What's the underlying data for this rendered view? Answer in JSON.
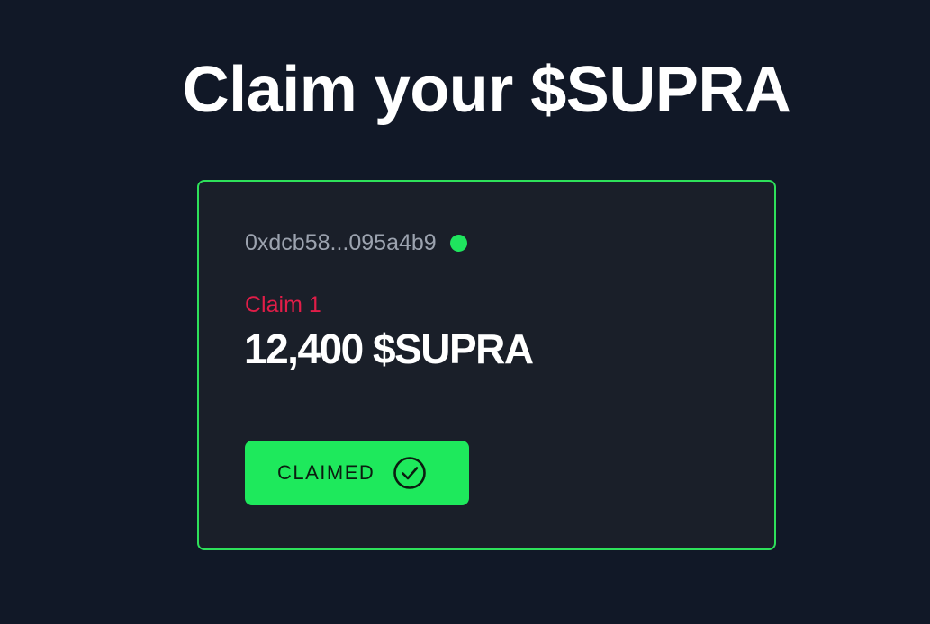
{
  "page": {
    "title": "Claim your $SUPRA"
  },
  "card": {
    "wallet_address": "0xdcb58...095a4b9",
    "wallet_status": "connected",
    "claim_label": "Claim 1",
    "claim_amount": "12,400 $SUPRA",
    "button_label": "CLAIMED",
    "button_icon": "check-circle-icon"
  },
  "colors": {
    "background": "#111827",
    "card_background": "#1a1f29",
    "card_border": "#2ee05a",
    "accent_green": "#1ee95c",
    "claim_label": "#e11d48",
    "address_text": "#9ca3af"
  }
}
